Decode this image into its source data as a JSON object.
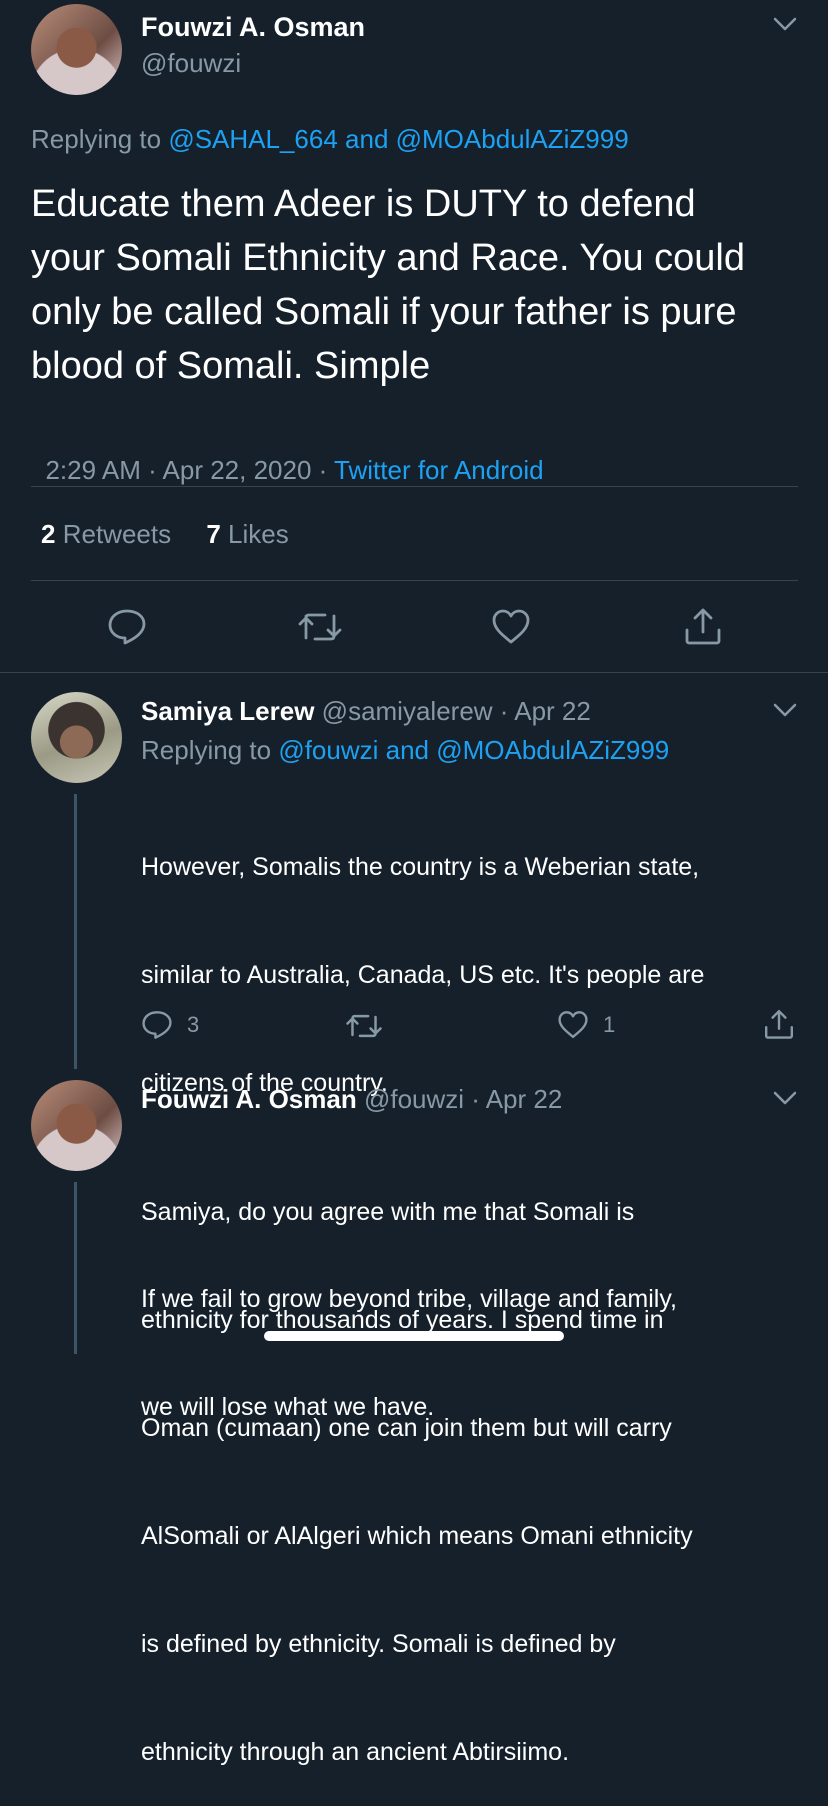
{
  "main_tweet": {
    "author_name": "Fouwzi A. Osman",
    "handle": "@fouwzi",
    "replying_prefix": "Replying to",
    "replying_users": "@SAHAL_664 and @MOAbdulAZiZ999",
    "text_lines": [
      "Educate them Adeer is DUTY to defend",
      "your Somali Ethnicity and Race. You could",
      "only be called Somali if your father is pure",
      "blood of Somali. Simple"
    ],
    "time": "2:29 AM · Apr 22, 2020 · ",
    "source": "Twitter for Android",
    "retweets_count": "2",
    "retweets_label": "Retweets",
    "likes_count": "7",
    "likes_label": "Likes"
  },
  "reply1": {
    "author_name": "Samiya Lerew",
    "meta": "@samiyalerew · Apr 22",
    "replying_prefix": "Replying to",
    "replying_users": "@fouwzi and @MOAbdulAZiZ999",
    "text_lines": [
      "However, Somalis the country is a Weberian state,",
      "similar to Australia, Canada, US etc. It's people are",
      "citizens of the country.",
      "",
      "If we fail to grow beyond tribe, village and family,",
      "we will lose what we have."
    ],
    "reply_count": "3",
    "like_count": "1"
  },
  "reply2": {
    "author_name": "Fouwzi A. Osman",
    "meta": "@fouwzi · Apr 22",
    "text_lines": [
      "Samiya, do you agree with me that Somali is",
      "ethnicity for thousands of years. I spend time in",
      "Oman (cumaan) one can join them but will carry",
      "AlSomali or AlAlgeri which means Omani ethnicity",
      "is defined by ethnicity. Somali is defined by",
      "ethnicity through an ancient Abtirsiimo."
    ]
  },
  "colors": {
    "background": "#15202b",
    "link": "#1da1f2",
    "muted": "#8899a6",
    "divider": "#38444d"
  }
}
